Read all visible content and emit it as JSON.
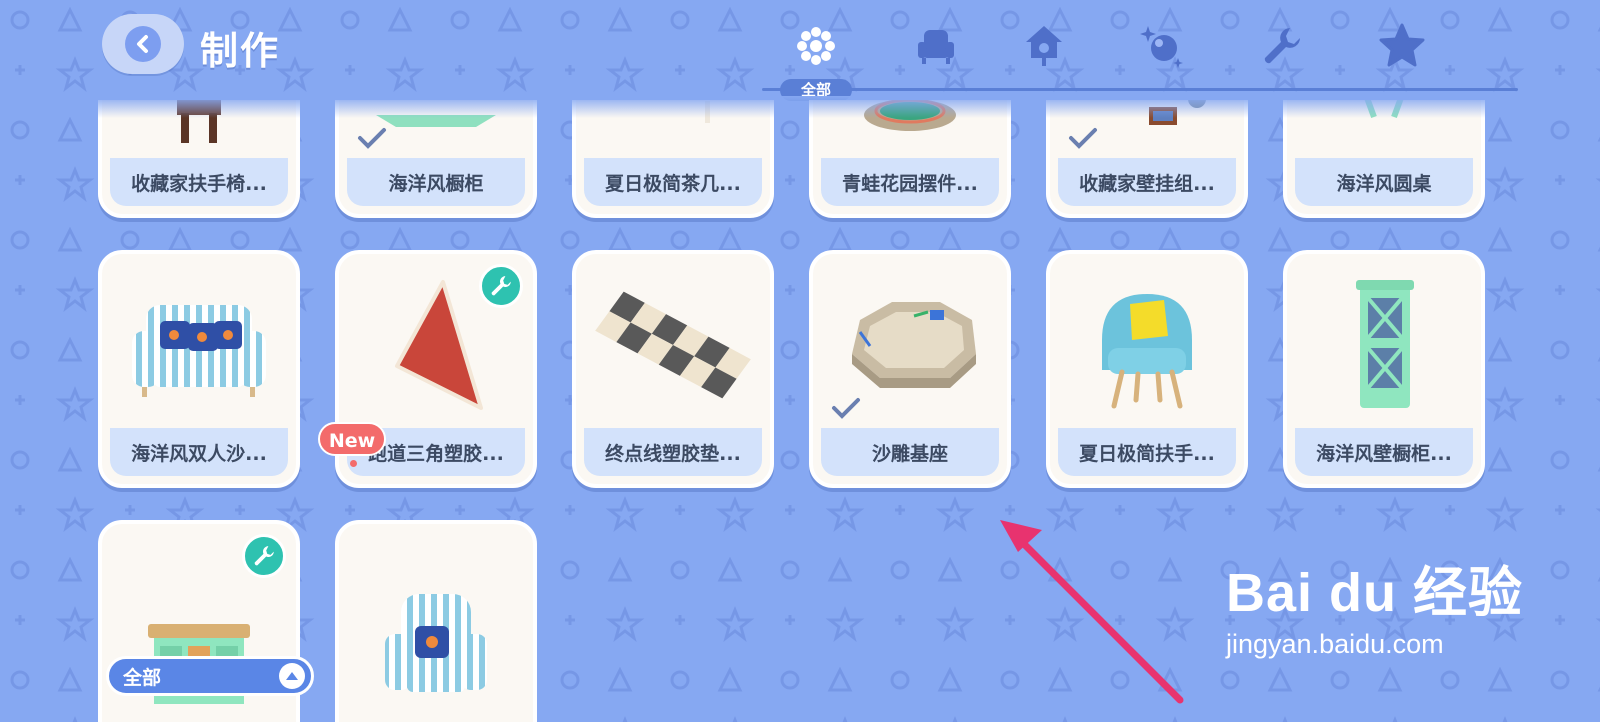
{
  "header": {
    "title": "制作",
    "active_tab_label": "全部",
    "tabs": [
      {
        "icon": "all-dots-icon"
      },
      {
        "icon": "armchair-icon"
      },
      {
        "icon": "birdhouse-icon"
      },
      {
        "icon": "sparkle-ball-icon"
      },
      {
        "icon": "wrench-icon"
      },
      {
        "icon": "star-icon"
      }
    ]
  },
  "items_row1": [
    {
      "label": "收藏家扶手椅...",
      "checked": false
    },
    {
      "label": "海洋风橱柜",
      "checked": true
    },
    {
      "label": "夏日极简茶几...",
      "checked": false
    },
    {
      "label": "青蛙花园摆件...",
      "checked": false
    },
    {
      "label": "收藏家壁挂组...",
      "checked": true
    },
    {
      "label": "海洋风圆桌",
      "checked": false
    }
  ],
  "items_row2": [
    {
      "label": "海洋风双人沙...",
      "icon": "striped-sofa-icon"
    },
    {
      "label": "跑道三角塑胶...",
      "icon": "triangle-mat-icon",
      "badge": "wrench"
    },
    {
      "label": "终点线塑胶垫...",
      "icon": "checkered-mat-icon"
    },
    {
      "label": "沙雕基座",
      "icon": "sandbox-icon",
      "checked": true
    },
    {
      "label": "夏日极简扶手...",
      "icon": "blue-armchair-icon"
    },
    {
      "label": "海洋风壁橱柜...",
      "icon": "green-cabinet-icon"
    }
  ],
  "items_row3": [
    {
      "icon": "green-sideboard-icon",
      "badge": "wrench"
    },
    {
      "icon": "striped-armchair-icon",
      "badge": "New"
    }
  ],
  "new_badge": "New",
  "filter": {
    "label": "全部"
  },
  "watermark": {
    "logo": "Bai du 经验",
    "url": "jingyan.baidu.com"
  },
  "colors": {
    "background": "#86a8f2",
    "accent": "#5a7fd6",
    "card": "#fbf8f3",
    "label_bar": "#d3e2fb",
    "arrow": "#e8336f",
    "badge_teal": "#2ec2b0"
  }
}
